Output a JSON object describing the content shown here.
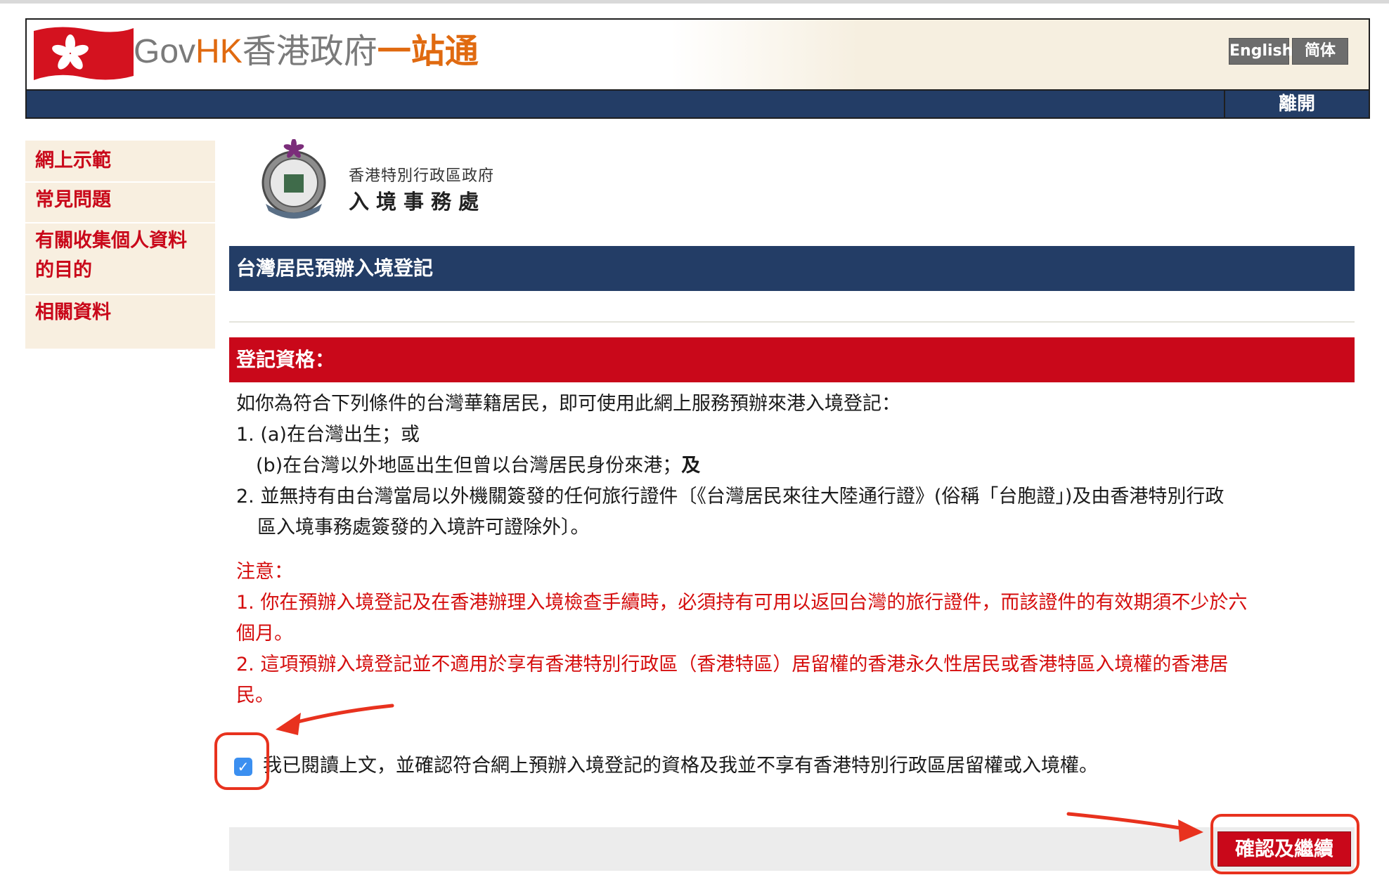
{
  "header": {
    "logo_gov": "Gov",
    "logo_hk": "HK",
    "logo_zh_part1": "香港政府",
    "logo_zh_part2": "一站通",
    "lang_english": "English",
    "lang_simplified": "简体",
    "exit_label": "離開"
  },
  "sidebar": {
    "items": [
      {
        "label": "網上示範"
      },
      {
        "label": "常見問題"
      },
      {
        "label": "有關收集個人資料"
      },
      {
        "label": "的目的"
      },
      {
        "label": "相關資料"
      }
    ]
  },
  "department": {
    "line1": "香港特別行政區政府",
    "line2": "入境事務處"
  },
  "main": {
    "title": "台灣居民預辦入境登記",
    "section_title": "登記資格：",
    "intro": "如你為符合下列條件的台灣華籍居民，即可使用此網上服務預辦來港入境登記：",
    "cond_1a": "1. (a)在台灣出生；或",
    "cond_1b": "(b)在台灣以外地區出生但曾以台灣居民身份來港；",
    "cond_1b_and": "及",
    "cond_2_line1": "2. 並無持有由台灣當局以外機關簽發的任何旅行證件〔《台灣居民來往大陸通行證》(俗稱「台胞證」)及由香港特別行政",
    "cond_2_line2": "區入境事務處簽發的入境許可證除外〕。",
    "note_title": "注意：",
    "note_1_line1": "1. 你在預辦入境登記及在香港辦理入境檢查手續時，必須持有可用以返回台灣的旅行證件，而該證件的有效期須不少於六",
    "note_1_line2": "個月。",
    "note_2_line1": "2. 這項預辦入境登記並不適用於享有香港特別行政區（香港特區）居留權的香港永久性居民或香港特區入境權的香港居",
    "note_2_line2": "民。",
    "declaration": "我已閱讀上文，並確認符合網上預辦入境登記的資格及我並不享有香港特別行政區居留權或入境權。",
    "checkbox_mark": "✓",
    "confirm_button": "確認及繼續"
  },
  "colors": {
    "navy": "#233d66",
    "red": "#c9081a",
    "sidebar_bg": "#f8efe0",
    "annotation": "#e8321e"
  }
}
